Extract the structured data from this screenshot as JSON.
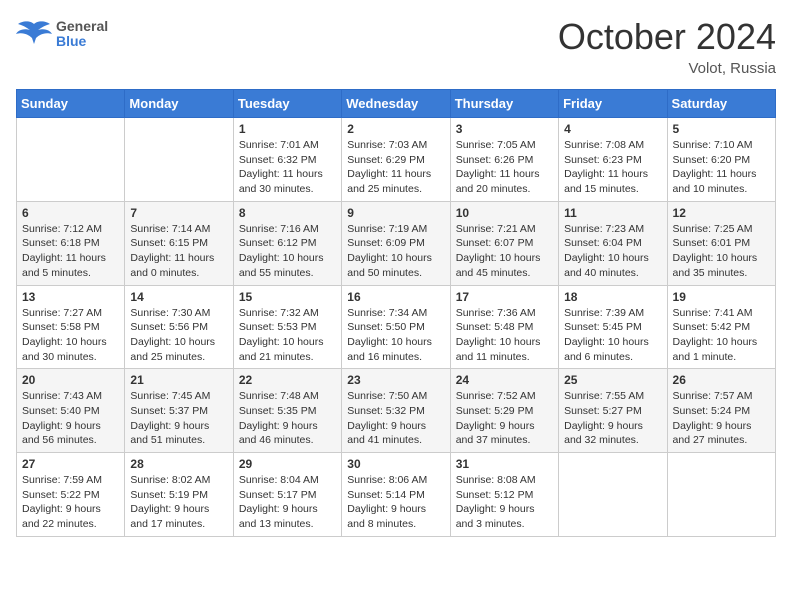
{
  "header": {
    "logo": {
      "general": "General",
      "blue": "Blue"
    },
    "title": "October 2024",
    "location": "Volot, Russia"
  },
  "calendar": {
    "weekdays": [
      "Sunday",
      "Monday",
      "Tuesday",
      "Wednesday",
      "Thursday",
      "Friday",
      "Saturday"
    ],
    "weeks": [
      [
        {
          "day": "",
          "info": ""
        },
        {
          "day": "",
          "info": ""
        },
        {
          "day": "1",
          "info": "Sunrise: 7:01 AM\nSunset: 6:32 PM\nDaylight: 11 hours and 30 minutes."
        },
        {
          "day": "2",
          "info": "Sunrise: 7:03 AM\nSunset: 6:29 PM\nDaylight: 11 hours and 25 minutes."
        },
        {
          "day": "3",
          "info": "Sunrise: 7:05 AM\nSunset: 6:26 PM\nDaylight: 11 hours and 20 minutes."
        },
        {
          "day": "4",
          "info": "Sunrise: 7:08 AM\nSunset: 6:23 PM\nDaylight: 11 hours and 15 minutes."
        },
        {
          "day": "5",
          "info": "Sunrise: 7:10 AM\nSunset: 6:20 PM\nDaylight: 11 hours and 10 minutes."
        }
      ],
      [
        {
          "day": "6",
          "info": "Sunrise: 7:12 AM\nSunset: 6:18 PM\nDaylight: 11 hours and 5 minutes."
        },
        {
          "day": "7",
          "info": "Sunrise: 7:14 AM\nSunset: 6:15 PM\nDaylight: 11 hours and 0 minutes."
        },
        {
          "day": "8",
          "info": "Sunrise: 7:16 AM\nSunset: 6:12 PM\nDaylight: 10 hours and 55 minutes."
        },
        {
          "day": "9",
          "info": "Sunrise: 7:19 AM\nSunset: 6:09 PM\nDaylight: 10 hours and 50 minutes."
        },
        {
          "day": "10",
          "info": "Sunrise: 7:21 AM\nSunset: 6:07 PM\nDaylight: 10 hours and 45 minutes."
        },
        {
          "day": "11",
          "info": "Sunrise: 7:23 AM\nSunset: 6:04 PM\nDaylight: 10 hours and 40 minutes."
        },
        {
          "day": "12",
          "info": "Sunrise: 7:25 AM\nSunset: 6:01 PM\nDaylight: 10 hours and 35 minutes."
        }
      ],
      [
        {
          "day": "13",
          "info": "Sunrise: 7:27 AM\nSunset: 5:58 PM\nDaylight: 10 hours and 30 minutes."
        },
        {
          "day": "14",
          "info": "Sunrise: 7:30 AM\nSunset: 5:56 PM\nDaylight: 10 hours and 25 minutes."
        },
        {
          "day": "15",
          "info": "Sunrise: 7:32 AM\nSunset: 5:53 PM\nDaylight: 10 hours and 21 minutes."
        },
        {
          "day": "16",
          "info": "Sunrise: 7:34 AM\nSunset: 5:50 PM\nDaylight: 10 hours and 16 minutes."
        },
        {
          "day": "17",
          "info": "Sunrise: 7:36 AM\nSunset: 5:48 PM\nDaylight: 10 hours and 11 minutes."
        },
        {
          "day": "18",
          "info": "Sunrise: 7:39 AM\nSunset: 5:45 PM\nDaylight: 10 hours and 6 minutes."
        },
        {
          "day": "19",
          "info": "Sunrise: 7:41 AM\nSunset: 5:42 PM\nDaylight: 10 hours and 1 minute."
        }
      ],
      [
        {
          "day": "20",
          "info": "Sunrise: 7:43 AM\nSunset: 5:40 PM\nDaylight: 9 hours and 56 minutes."
        },
        {
          "day": "21",
          "info": "Sunrise: 7:45 AM\nSunset: 5:37 PM\nDaylight: 9 hours and 51 minutes."
        },
        {
          "day": "22",
          "info": "Sunrise: 7:48 AM\nSunset: 5:35 PM\nDaylight: 9 hours and 46 minutes."
        },
        {
          "day": "23",
          "info": "Sunrise: 7:50 AM\nSunset: 5:32 PM\nDaylight: 9 hours and 41 minutes."
        },
        {
          "day": "24",
          "info": "Sunrise: 7:52 AM\nSunset: 5:29 PM\nDaylight: 9 hours and 37 minutes."
        },
        {
          "day": "25",
          "info": "Sunrise: 7:55 AM\nSunset: 5:27 PM\nDaylight: 9 hours and 32 minutes."
        },
        {
          "day": "26",
          "info": "Sunrise: 7:57 AM\nSunset: 5:24 PM\nDaylight: 9 hours and 27 minutes."
        }
      ],
      [
        {
          "day": "27",
          "info": "Sunrise: 7:59 AM\nSunset: 5:22 PM\nDaylight: 9 hours and 22 minutes."
        },
        {
          "day": "28",
          "info": "Sunrise: 8:02 AM\nSunset: 5:19 PM\nDaylight: 9 hours and 17 minutes."
        },
        {
          "day": "29",
          "info": "Sunrise: 8:04 AM\nSunset: 5:17 PM\nDaylight: 9 hours and 13 minutes."
        },
        {
          "day": "30",
          "info": "Sunrise: 8:06 AM\nSunset: 5:14 PM\nDaylight: 9 hours and 8 minutes."
        },
        {
          "day": "31",
          "info": "Sunrise: 8:08 AM\nSunset: 5:12 PM\nDaylight: 9 hours and 3 minutes."
        },
        {
          "day": "",
          "info": ""
        },
        {
          "day": "",
          "info": ""
        }
      ]
    ]
  }
}
